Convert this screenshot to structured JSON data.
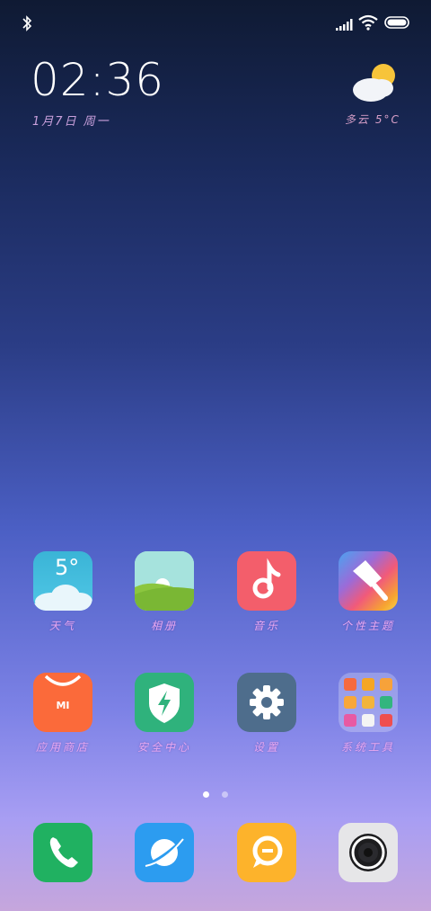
{
  "status_bar": {
    "icons": [
      "bluetooth-icon",
      "signal-icon",
      "wifi-icon",
      "battery-icon"
    ]
  },
  "widget": {
    "time": "02:36",
    "date": "1月7日 周一",
    "weather": "多云  5°C",
    "weather_icon": "partly-cloudy-icon"
  },
  "apps": [
    {
      "label": "天气",
      "icon": "weather-app-icon",
      "tile_text": "5°"
    },
    {
      "label": "相册",
      "icon": "gallery-app-icon"
    },
    {
      "label": "音乐",
      "icon": "music-app-icon"
    },
    {
      "label": "个性主题",
      "icon": "themes-app-icon"
    },
    {
      "label": "应用商店",
      "icon": "app-store-icon",
      "tile_text": "MI"
    },
    {
      "label": "安全中心",
      "icon": "security-center-icon"
    },
    {
      "label": "设置",
      "icon": "settings-icon"
    },
    {
      "label": "系统工具",
      "icon": "system-tools-folder-icon"
    }
  ],
  "page_indicator": {
    "pages": 2,
    "current": 1
  },
  "dock": [
    {
      "icon": "phone-icon"
    },
    {
      "icon": "browser-icon"
    },
    {
      "icon": "messages-icon"
    },
    {
      "icon": "camera-icon"
    }
  ]
}
